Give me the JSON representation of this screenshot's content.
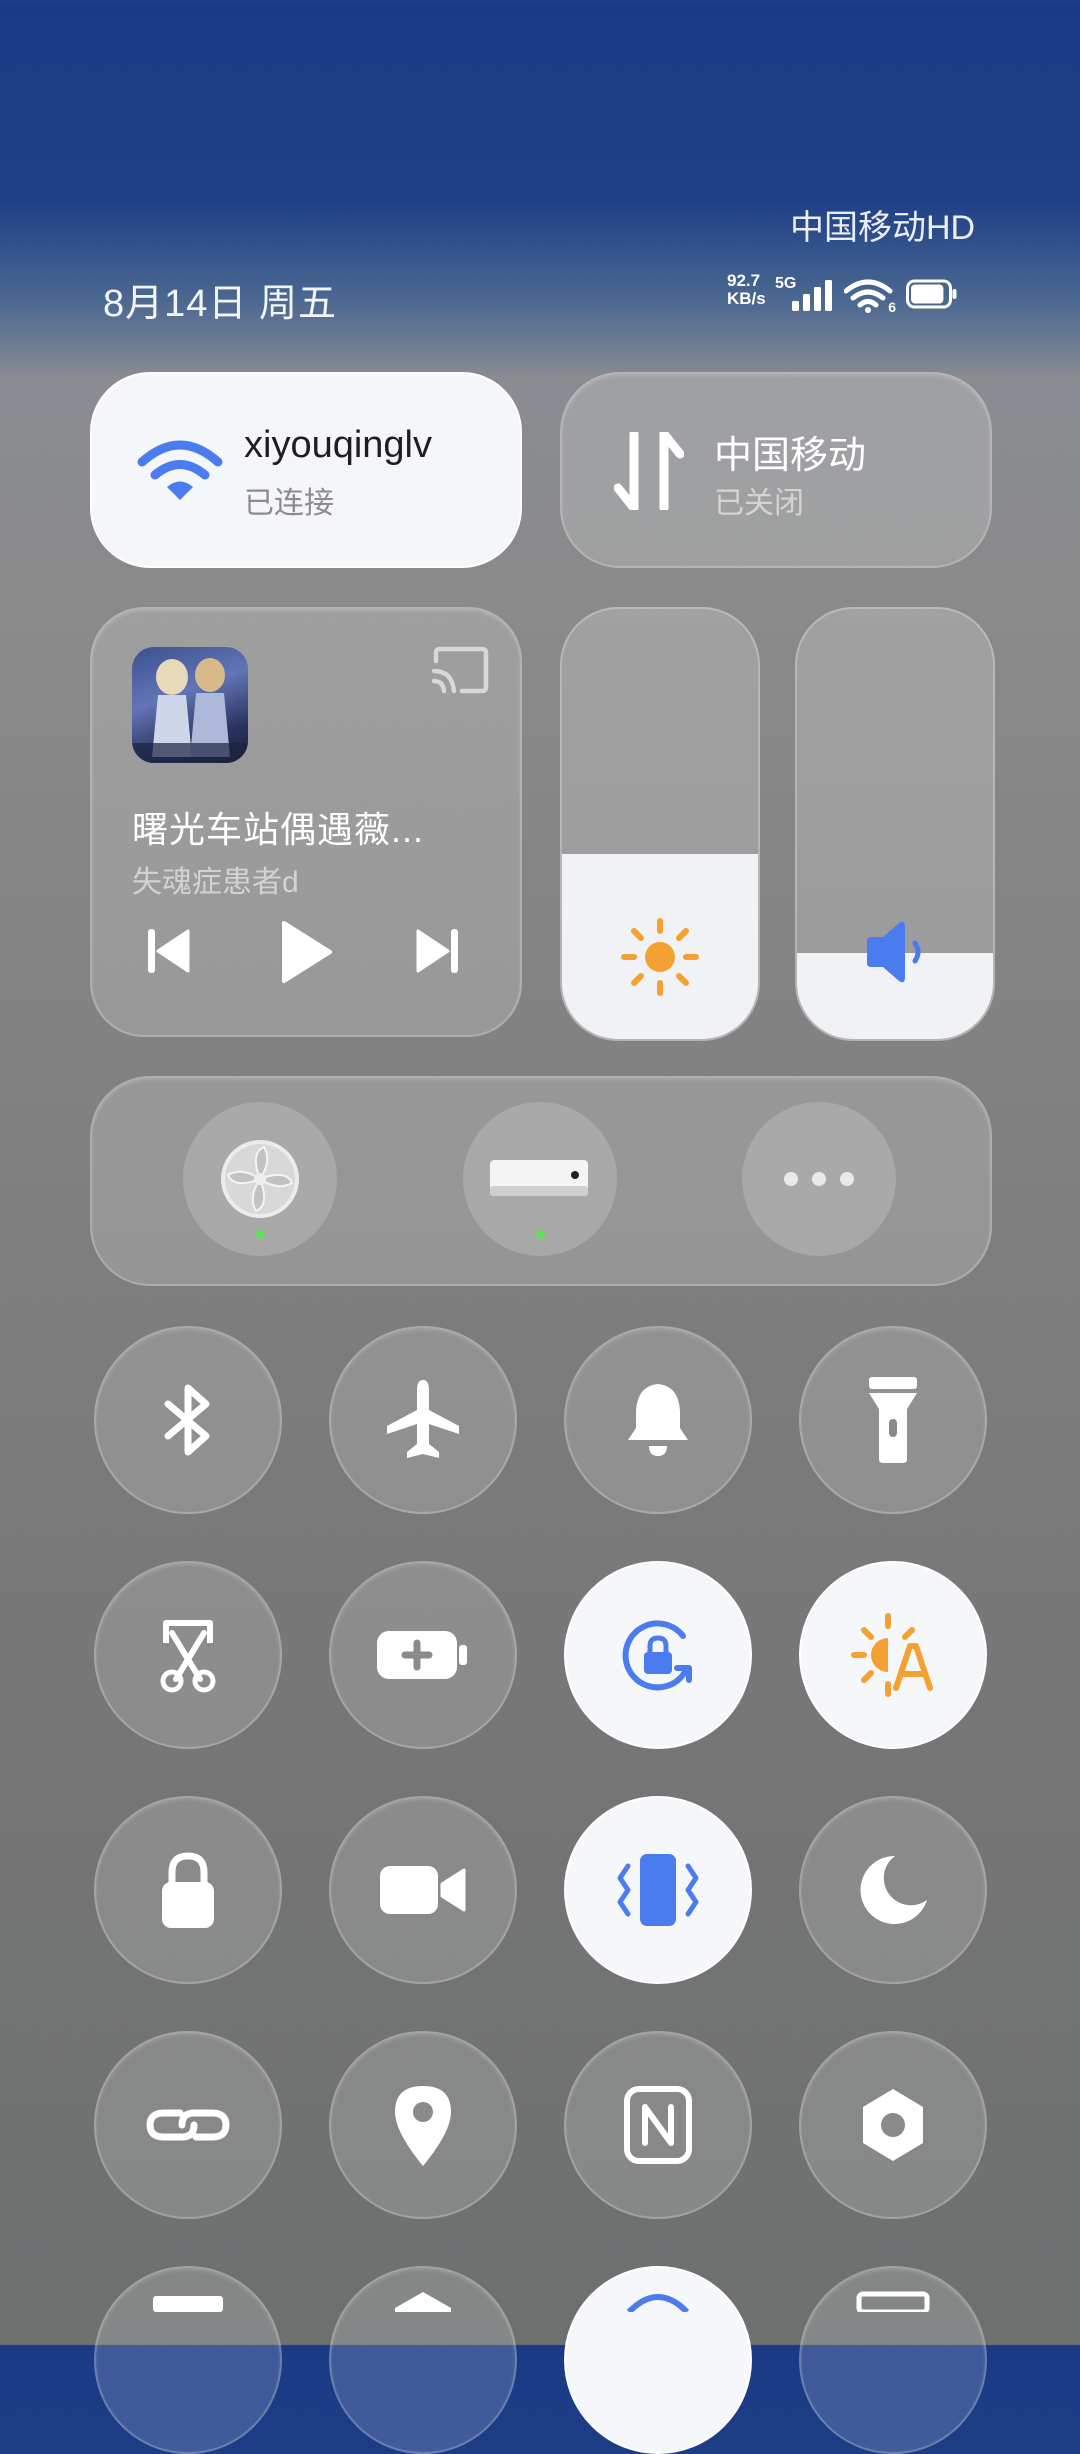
{
  "status_bar": {
    "carrier": "中国移动HD",
    "date": "8月14日 周五",
    "net_speed_value": "92.7",
    "net_speed_unit": "KB/s",
    "network_type": "5G",
    "wifi_standard": "6",
    "battery_level_percent": 90
  },
  "wifi_tile": {
    "title": "xiyouqinglv",
    "subtitle": "已连接",
    "icon": "wifi-icon",
    "active": true
  },
  "mobile_tile": {
    "title": "中国移动",
    "subtitle": "已关闭",
    "icon": "mobile-data-icon",
    "active": false
  },
  "media": {
    "song": "曙光车站偶遇薇...",
    "artist": "失魂症患者d",
    "controls": [
      "previous-icon",
      "play-icon",
      "next-icon"
    ],
    "cast_icon": "cast-icon"
  },
  "sliders": {
    "brightness_level": 0.43,
    "volume_level": 0.2
  },
  "devices": [
    {
      "name": "fan",
      "icon": "fan-icon",
      "online": true
    },
    {
      "name": "air-conditioner",
      "icon": "air-conditioner-icon",
      "online": true
    },
    {
      "name": "more",
      "icon": "more-icon",
      "online": false
    }
  ],
  "toggles": [
    {
      "name": "bluetooth",
      "icon": "bluetooth-icon",
      "active": false
    },
    {
      "name": "airplane",
      "icon": "airplane-icon",
      "active": false
    },
    {
      "name": "silent",
      "icon": "bell-icon",
      "active": false
    },
    {
      "name": "flashlight",
      "icon": "flashlight-icon",
      "active": false
    },
    {
      "name": "screenshot",
      "icon": "screenshot-icon",
      "active": false
    },
    {
      "name": "battery-saver",
      "icon": "battery-saver-icon",
      "active": false
    },
    {
      "name": "rotation-lock",
      "icon": "rotation-lock-icon",
      "active": true
    },
    {
      "name": "auto-brightness",
      "icon": "auto-brightness-icon",
      "active": true
    },
    {
      "name": "lock-screen",
      "icon": "lock-icon",
      "active": false
    },
    {
      "name": "screen-record",
      "icon": "video-camera-icon",
      "active": false
    },
    {
      "name": "vibrate",
      "icon": "vibrate-icon",
      "active": true
    },
    {
      "name": "dark-mode",
      "icon": "moon-icon",
      "active": false
    },
    {
      "name": "link-share",
      "icon": "link-icon",
      "active": false
    },
    {
      "name": "location",
      "icon": "location-icon",
      "active": false
    },
    {
      "name": "nfc",
      "icon": "nfc-icon",
      "active": false
    },
    {
      "name": "settings",
      "icon": "settings-icon",
      "active": false
    }
  ],
  "colors": {
    "accent_blue": "#4a7cf0",
    "accent_orange": "#f4a032",
    "online_dot": "#5fe05a"
  }
}
